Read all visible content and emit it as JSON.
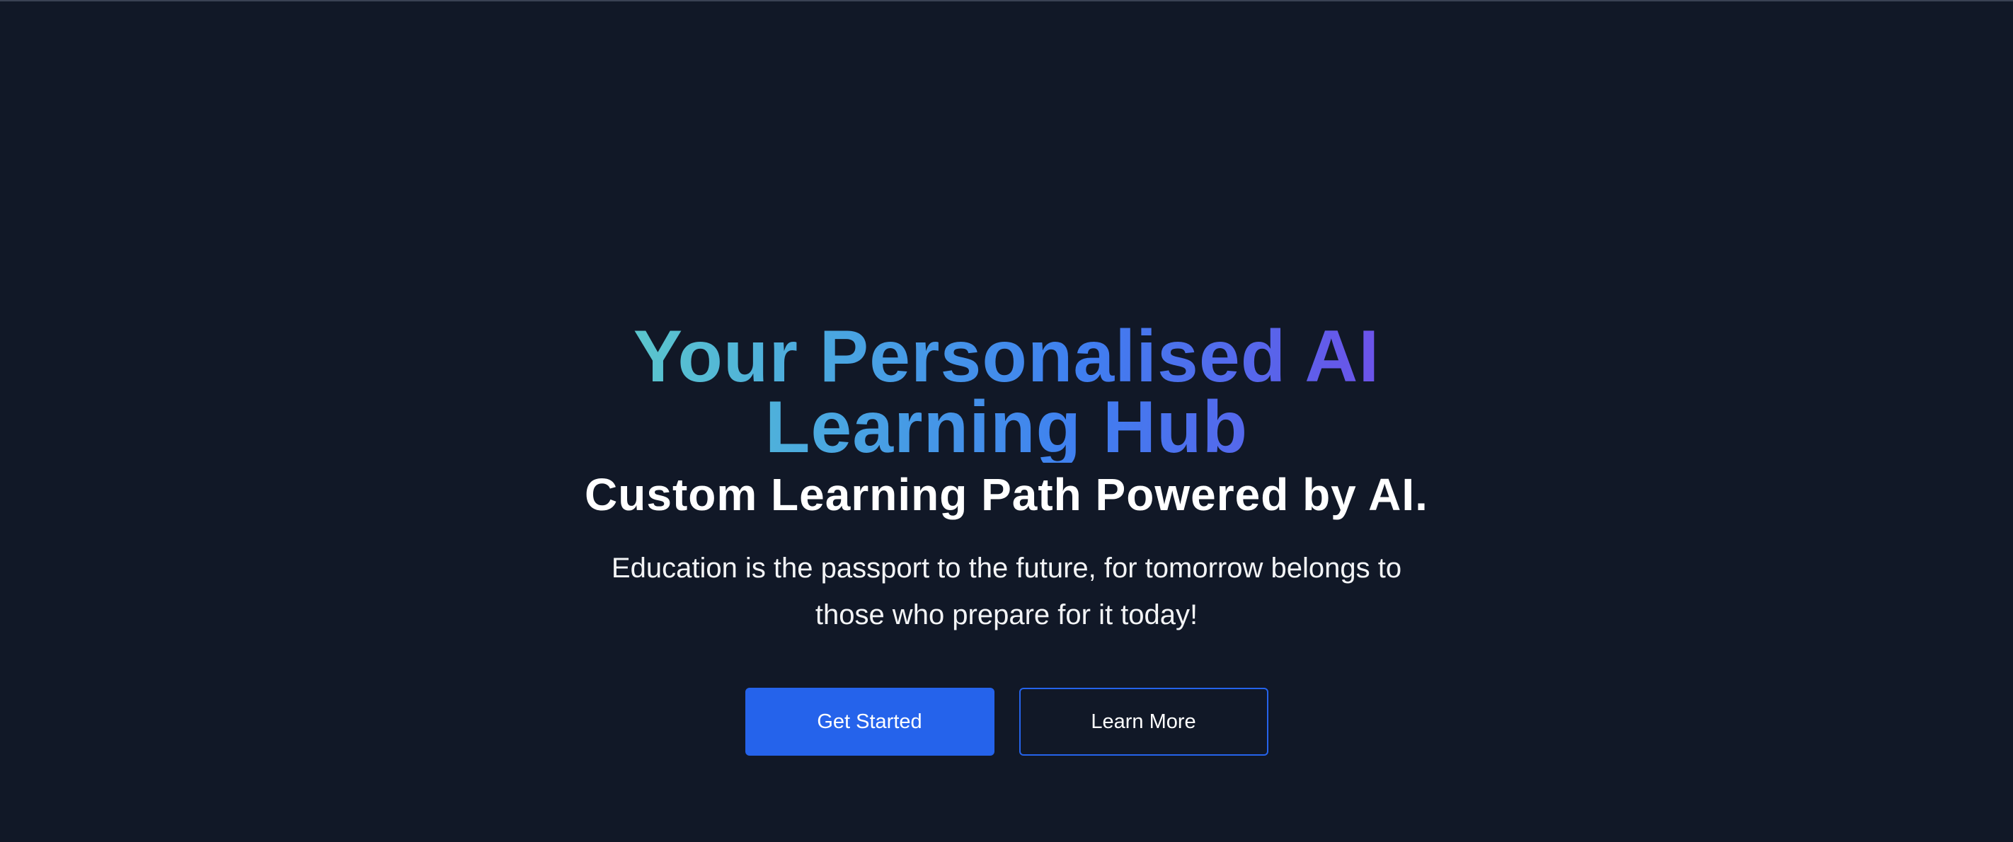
{
  "hero": {
    "title": "Your Personalised AI Learning Hub",
    "subtitle": "Custom Learning Path Powered by AI.",
    "tagline": "Education is the passport to the future, for tomorrow belongs to those who prepare for it today!"
  },
  "actions": {
    "primary_label": "Get Started",
    "secondary_label": "Learn More"
  },
  "colors": {
    "background": "#111827",
    "accent": "#2563eb",
    "gradient_start": "#63d3c4",
    "gradient_mid": "#3f7ff0",
    "gradient_end": "#7e45e8"
  }
}
